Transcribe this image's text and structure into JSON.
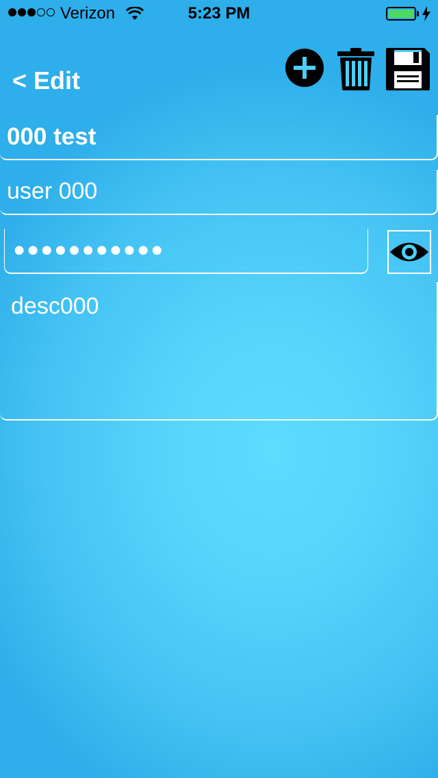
{
  "status_bar": {
    "carrier": "Verizon",
    "time": "5:23 PM",
    "signal_full": 3,
    "signal_total": 5,
    "battery_level": 1.0,
    "battery_color": "#4cd964"
  },
  "nav": {
    "back_label": "< Edit",
    "icons": [
      "add-circle-icon",
      "trash-icon",
      "save-floppy-icon"
    ]
  },
  "form": {
    "title": "000 test",
    "username": "user 000",
    "password_masked": "●●●●●●●●●●●",
    "description": "desc000",
    "reveal_icon": "eye-icon"
  },
  "theme": {
    "background": "#57d6fd",
    "text_color": "#ffffff"
  }
}
